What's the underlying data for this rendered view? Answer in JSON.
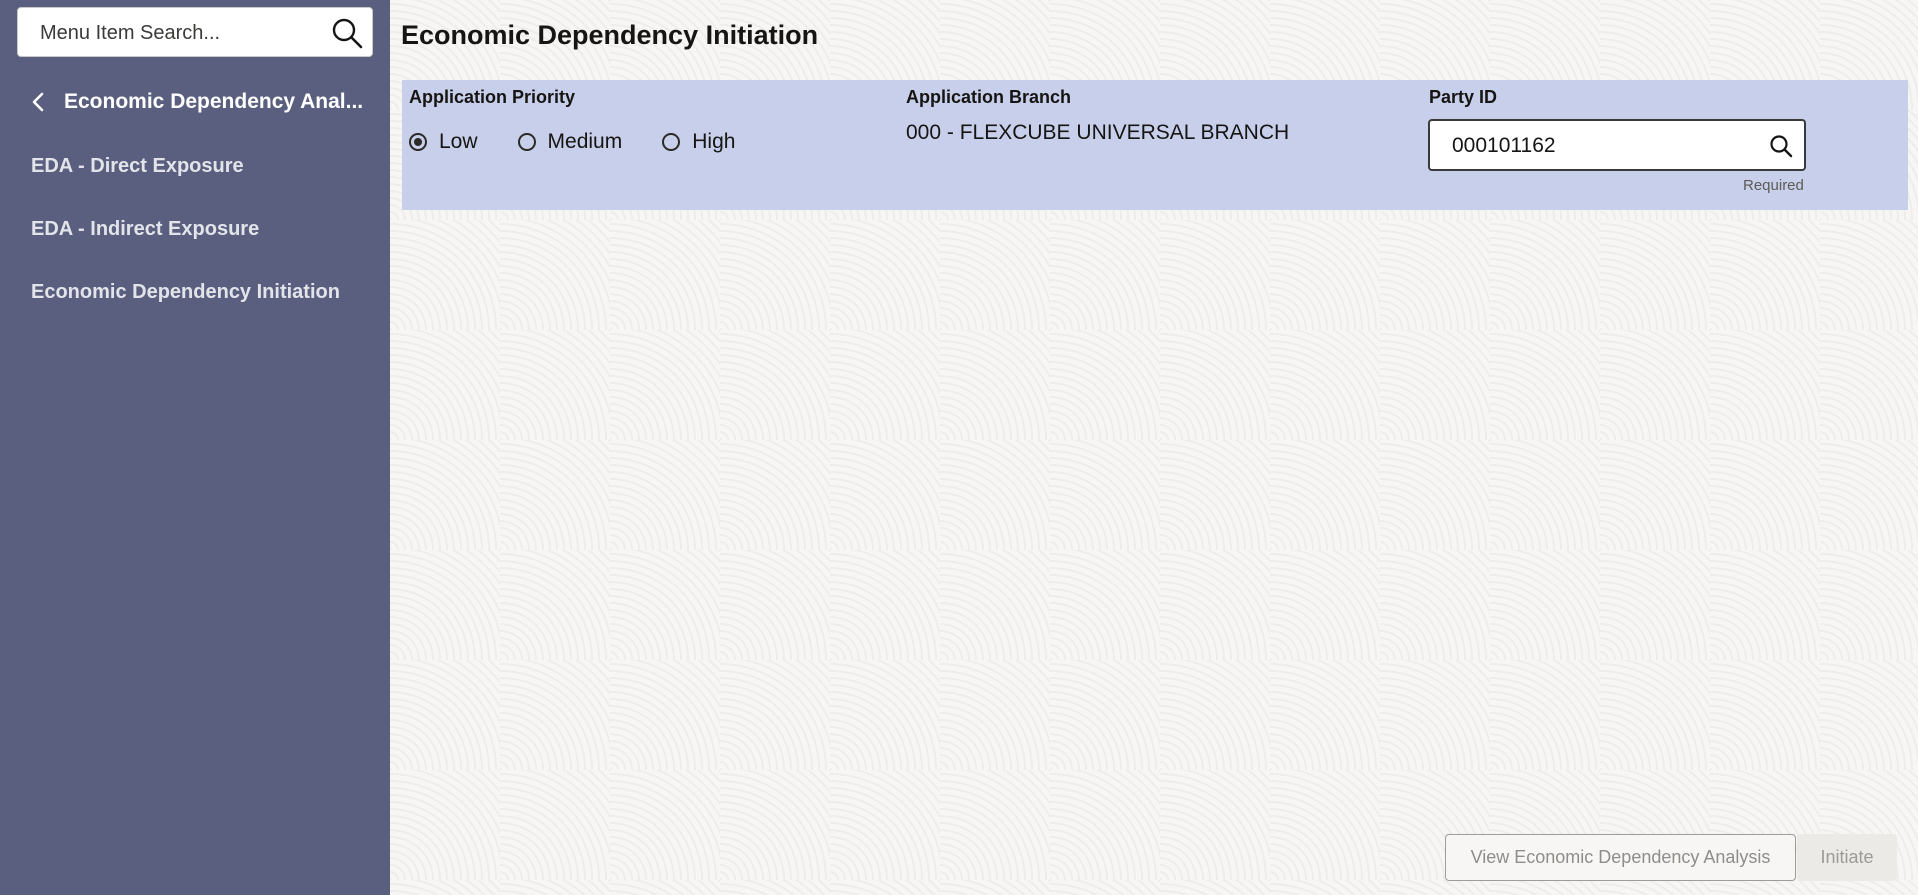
{
  "sidebar": {
    "search_placeholder": "Menu Item Search...",
    "back_label": "Economic Dependency Anal...",
    "items": [
      {
        "label": "EDA - Direct Exposure"
      },
      {
        "label": "EDA - Indirect Exposure"
      },
      {
        "label": "Economic Dependency Initiation"
      }
    ]
  },
  "main": {
    "title": "Economic Dependency Initiation",
    "form": {
      "priority_label": "Application Priority",
      "priority_options": [
        "Low",
        "Medium",
        "High"
      ],
      "priority_selected": "Low",
      "branch_label": "Application Branch",
      "branch_value": "000 - FLEXCUBE UNIVERSAL BRANCH",
      "party_label": "Party ID",
      "party_value": "000101162",
      "party_hint": "Required"
    },
    "buttons": {
      "view": "View Economic Dependency Analysis",
      "initiate": "Initiate"
    }
  },
  "colors": {
    "sidebar_bg": "#5a5f7f",
    "panel_bg": "#c8cfea",
    "page_bg": "#f7f6f4"
  },
  "icons": {
    "search": "search-icon",
    "back": "chevron-left-icon",
    "lookup": "search-icon"
  }
}
